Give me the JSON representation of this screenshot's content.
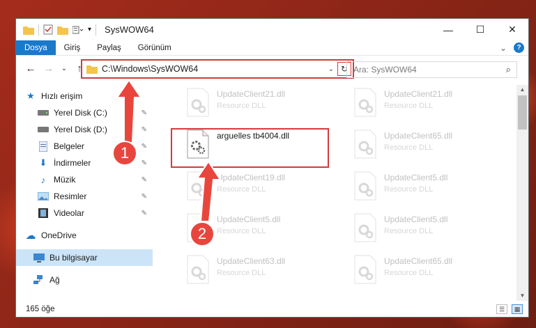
{
  "window": {
    "title": "SysWOW64",
    "controls": {
      "minimize": "—",
      "maximize": "☐",
      "close": "✕"
    }
  },
  "ribbon": {
    "tabs": [
      "Dosya",
      "Giriş",
      "Paylaş",
      "Görünüm"
    ],
    "active_tab": "Dosya",
    "expand": "⌄",
    "help": "?"
  },
  "navigation": {
    "back": "←",
    "forward": "→",
    "recent": "⌄",
    "up": "↑",
    "address_path": "C:\\Windows\\SysWOW64",
    "address_dropdown": "⌄",
    "refresh": "↻",
    "search_placeholder": "Ara: SysWOW64",
    "search_icon": "⌕"
  },
  "sidebar": {
    "items": [
      {
        "label": "Hızlı erişim",
        "icon": "star-icon",
        "glyph": "★",
        "color": "#1979ca",
        "pinned": false
      },
      {
        "label": "Yerel Disk (C:)",
        "icon": "drive-icon",
        "glyph": "▬",
        "color": "#555555",
        "pinned": true
      },
      {
        "label": "Yerel Disk (D:)",
        "icon": "drive-icon",
        "glyph": "▬",
        "color": "#555555",
        "pinned": true
      },
      {
        "label": "Belgeler",
        "icon": "documents-icon",
        "glyph": "▤",
        "color": "#4a6fa5",
        "pinned": true
      },
      {
        "label": "İndirmeler",
        "icon": "download-icon",
        "glyph": "⬇",
        "color": "#1979ca",
        "pinned": true
      },
      {
        "label": "Müzik",
        "icon": "music-icon",
        "glyph": "♪",
        "color": "#1979ca",
        "pinned": true
      },
      {
        "label": "Resimler",
        "icon": "pictures-icon",
        "glyph": "▨",
        "color": "#4a8ac8",
        "pinned": true
      },
      {
        "label": "Videolar",
        "icon": "video-icon",
        "glyph": "▣",
        "color": "#333333",
        "pinned": true
      },
      {
        "label": "OneDrive",
        "icon": "cloud-icon",
        "glyph": "☁",
        "color": "#1979ca",
        "pinned": false
      },
      {
        "label": "Bu bilgisayar",
        "icon": "computer-icon",
        "glyph": "▭",
        "color": "#3a87d0",
        "pinned": false,
        "selected": true
      },
      {
        "label": "Ağ",
        "icon": "network-icon",
        "glyph": "⛁",
        "color": "#3a87d0",
        "pinned": false
      }
    ],
    "pin_glyph": "📌"
  },
  "files": [
    {
      "name": "UpdateClient21.dll",
      "type": "Resource DLL",
      "faded": true
    },
    {
      "name": "UpdateClient21.dll",
      "type": "Resource DLL",
      "faded": true
    },
    {
      "name": "arguelles tb4004.dll",
      "type": "",
      "faded": false
    },
    {
      "name": "UpdateClient65.dll",
      "type": "Resource DLL",
      "faded": true
    },
    {
      "name": "UpdateClient19.dll",
      "type": "Resource DLL",
      "faded": true
    },
    {
      "name": "UpdateClient5.dll",
      "type": "Resource DLL",
      "faded": true
    },
    {
      "name": "UpdateClient5.dll",
      "type": "Resource DLL",
      "faded": true
    },
    {
      "name": "UpdateClient5.dll",
      "type": "Resource DLL",
      "faded": true
    },
    {
      "name": "UpdateClient63.dll",
      "type": "Resource DLL",
      "faded": true
    },
    {
      "name": "UpdateClient65.dll",
      "type": "Resource DLL",
      "faded": true
    }
  ],
  "status": {
    "item_count": "165 öğe",
    "view_details": "☰",
    "view_tiles": "▦"
  },
  "annotations": {
    "badge_1": "1",
    "badge_2": "2",
    "accent": "#e8463d"
  }
}
